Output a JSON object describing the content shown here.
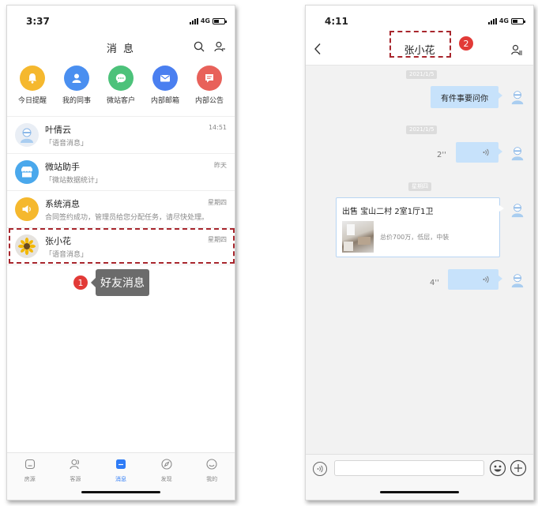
{
  "screen1": {
    "status": {
      "time": "3:37",
      "network": "4G"
    },
    "title": "消 息",
    "quick_actions": [
      {
        "label": "今日提醒",
        "icon": "bell-icon",
        "color": "#f5b82e"
      },
      {
        "label": "我的同事",
        "icon": "person-icon",
        "color": "#4a8ff0"
      },
      {
        "label": "微站客户",
        "icon": "chat-icon",
        "color": "#4cc27a"
      },
      {
        "label": "内部邮箱",
        "icon": "mail-icon",
        "color": "#4a7ff0"
      },
      {
        "label": "内部公告",
        "icon": "notice-icon",
        "color": "#e8615a"
      }
    ],
    "messages": [
      {
        "name": "叶倩云",
        "preview": "「语音消息」",
        "time": "14:51"
      },
      {
        "name": "微站助手",
        "preview": "「微站数据统计」",
        "time": "昨天"
      },
      {
        "name": "系统消息",
        "preview": "合同签约成功，管理员给您分配任务，请尽快处理。",
        "time": "星期四"
      },
      {
        "name": "张小花",
        "preview": "「语音消息」",
        "time": "星期四"
      }
    ],
    "step_number": "1",
    "tooltip": "好友消息",
    "tabs": [
      {
        "label": "房源",
        "icon": "house-icon"
      },
      {
        "label": "客源",
        "icon": "people-icon"
      },
      {
        "label": "消息",
        "icon": "message-icon"
      },
      {
        "label": "发现",
        "icon": "compass-icon"
      },
      {
        "label": "我的",
        "icon": "smile-icon"
      }
    ]
  },
  "screen2": {
    "status": {
      "time": "4:11",
      "network": "4G"
    },
    "title": "张小花",
    "step_number": "2",
    "timestamps": [
      "2021/1/5",
      "2021/1/5",
      "星期四"
    ],
    "text_message": "有件事要问你",
    "voice_messages": [
      {
        "duration": "2''"
      },
      {
        "duration": "4''"
      }
    ],
    "listing_card": {
      "title": "出售  宝山二村 2室1厅1卫",
      "summary": "总价700万，低层，中装"
    }
  },
  "colors": {
    "accent": "#2f7cf6",
    "highlight": "#a8262d",
    "step": "#e23a37",
    "bubble": "#c7e2fb"
  }
}
